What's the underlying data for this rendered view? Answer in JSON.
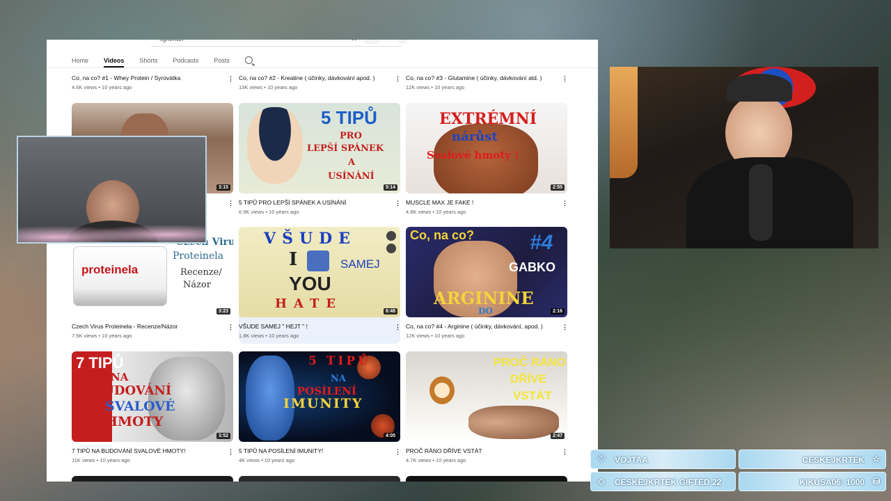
{
  "search": {
    "query": "fightman"
  },
  "tabs": [
    "Home",
    "Videos",
    "Shorts",
    "Podcasts",
    "Posts"
  ],
  "row0": [
    {
      "title": "Co, na co? #1 - Whey Protein / Syrovátka",
      "meta": "4.6K views • 10 years ago"
    },
    {
      "title": "Co, na co? #2 - Kreatine ( účinky, dávkování apod. )",
      "meta": "13K views • 10 years ago"
    },
    {
      "title": "Co, na co? #3 - Glutamine ( účinky, dávkování atd. )",
      "meta": "12K views • 10 years ago"
    }
  ],
  "row1": [
    {
      "title": "",
      "meta": "",
      "duration": "3:15"
    },
    {
      "title": "5 TIPŮ PRO LEPŠÍ SPÁNEK A USÍNÁNÍ",
      "meta": "6.9K views • 10 years ago",
      "duration": "5:14",
      "thumb": {
        "l1": "5 TIPŮ",
        "l2": "PRO",
        "l3": "LEPŠÍ SPÁNEK",
        "l4": "A",
        "l5": "USÍNÁNÍ"
      }
    },
    {
      "title": "MUSCLE MAX JE FAKE !",
      "meta": "4.8K views • 10 years ago",
      "duration": "2:55",
      "thumb": {
        "l1": "EXTRÉMNÍ",
        "l2": "nárůst",
        "l3": "Svalové hmoty !"
      }
    }
  ],
  "row2": [
    {
      "title": "Czech Virus Proteinela - Recenze/Názor",
      "meta": "7.5K views • 10 years ago",
      "duration": "3:23",
      "thumb": {
        "brand": "proteinela",
        "l1": "Czech Virus",
        "l2": "Proteinela",
        "l3": "Recenze/",
        "l4": "Názor"
      }
    },
    {
      "title": "VŠUDE SAMEJ \" HEJT \" !",
      "meta": "1.8K views • 10 years ago",
      "duration": "6:48",
      "thumb": {
        "l1": "VŠUDE",
        "l2": "I",
        "l3": "SAMEJ",
        "l4": "YOU",
        "l5": "HATE"
      }
    },
    {
      "title": "Co, na co? #4 - Arginine ( účinky, dávkování, apod. )",
      "meta": "12K views • 10 years ago",
      "duration": "2:16",
      "thumb": {
        "l1": "Co, na co?",
        "l2": "#4",
        "l3": "GABKO",
        "l4": "ARGININE",
        "l5": "DO"
      }
    }
  ],
  "row3": [
    {
      "title": "7 TIPŮ NA BUDOVÁNÍ SVALOVÉ HMOTY!",
      "meta": "11K views • 10 years ago",
      "duration": "3:52",
      "thumb": {
        "l1": "7 TIPŮ",
        "l2": "NA",
        "l3": "BUDOVÁNÍ",
        "l4": "SVALOVÉ",
        "l5": "HMOTY"
      }
    },
    {
      "title": "5 TIPŮ NA POSÍLENÍ IMUNITY!",
      "meta": "4K views • 10 years ago",
      "duration": "4:05",
      "thumb": {
        "l1": "5 TIPŮ",
        "l2": "NA",
        "l3": "POSÍLENÍ",
        "l4": "IMUNITY"
      }
    },
    {
      "title": "PROČ RÁNO DŘÍVE VSTÁT",
      "meta": "4.7K views • 10 years ago",
      "duration": "2:47",
      "thumb": {
        "l1": "PROČ RÁNO",
        "l2": "DŘÍVE",
        "l3": "VSTÁT"
      }
    }
  ],
  "alerts": {
    "a1": "VOJTAA",
    "a2": "CESKEJKRTEK",
    "a3": "CESKEJKRTEK GIFTED 22",
    "a4": "KIKUSA06: 1000"
  },
  "colors": {
    "accent": "#0f0f0f",
    "alert": "#a9d8f0"
  }
}
